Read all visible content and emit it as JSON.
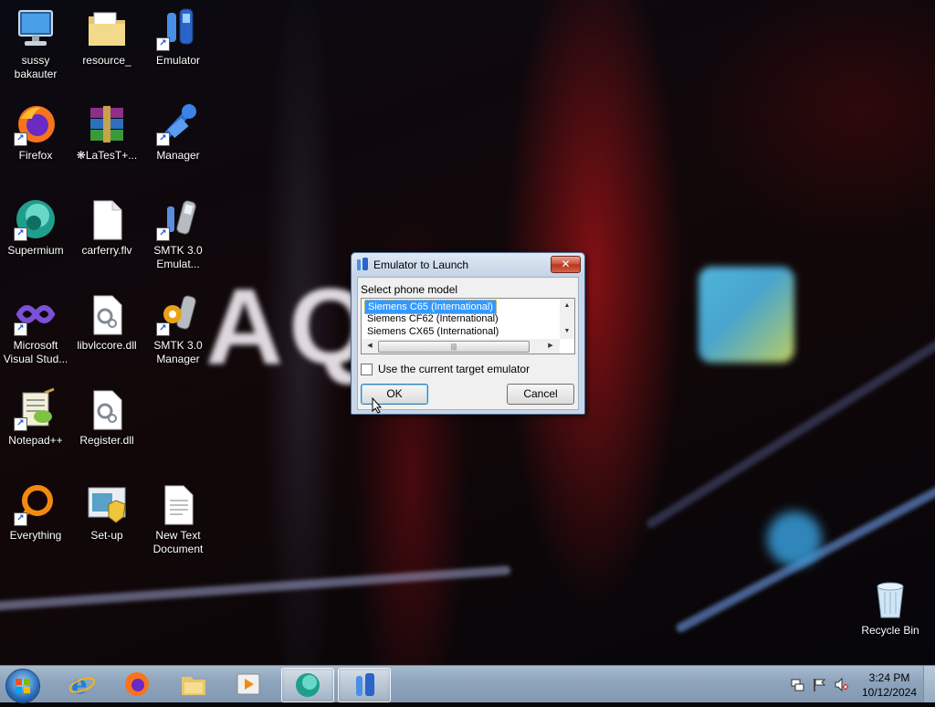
{
  "desktop": {
    "icons": [
      {
        "label": "sussy bakauter",
        "icon": "computer-icon"
      },
      {
        "label": "resource_",
        "icon": "folder-icon"
      },
      {
        "label": "Emulator",
        "icon": "emulator-icon"
      },
      {
        "label": "Firefox",
        "icon": "firefox-icon"
      },
      {
        "label": "❋LaTesT+...",
        "icon": "winrar-icon"
      },
      {
        "label": "Manager",
        "icon": "manager-icon"
      },
      {
        "label": "Supermium",
        "icon": "supermium-icon"
      },
      {
        "label": "carferry.flv",
        "icon": "file-icon"
      },
      {
        "label": "SMTK 3.0 Emulat...",
        "icon": "smtk-emulator-icon"
      },
      {
        "label": "Microsoft Visual Stud...",
        "icon": "visual-studio-icon"
      },
      {
        "label": "libvlccore.dll",
        "icon": "dll-icon"
      },
      {
        "label": "SMTK 3.0 Manager",
        "icon": "smtk-manager-icon"
      },
      {
        "label": "Notepad++",
        "icon": "notepadpp-icon"
      },
      {
        "label": "Register.dll",
        "icon": "dll-icon"
      },
      {
        "label": "Everything",
        "icon": "everything-icon"
      },
      {
        "label": "Set-up",
        "icon": "setup-icon"
      },
      {
        "label": "New Text Document",
        "icon": "text-document-icon"
      },
      {
        "label": "Recycle Bin",
        "icon": "recycle-bin-icon"
      }
    ]
  },
  "dialog": {
    "title": "Emulator to Launch",
    "close_label": "✕",
    "prompt": "Select phone model",
    "models": [
      "Siemens C65 (International)",
      "Siemens CF62 (International)",
      "Siemens CX65 (International)"
    ],
    "selected_index": 0,
    "checkbox_label": "Use the current target emulator",
    "checkbox_checked": false,
    "ok_label": "OK",
    "cancel_label": "Cancel"
  },
  "taskbar": {
    "pinned": [
      {
        "icon": "start-orb-icon"
      },
      {
        "icon": "internet-explorer-icon"
      },
      {
        "icon": "firefox-icon"
      },
      {
        "icon": "file-explorer-icon"
      },
      {
        "icon": "media-player-icon"
      },
      {
        "icon": "supermium-icon",
        "active": true
      },
      {
        "icon": "emulator-icon",
        "active": true
      }
    ],
    "tray": [
      "network-icon",
      "action-center-flag-icon",
      "volume-muted-icon"
    ],
    "time": "3:24 PM",
    "date": "10/12/2024"
  },
  "colors": {
    "dialog_frame": "#c7d6e8",
    "selection": "#3399ff",
    "taskbar": "#8ea5bd"
  }
}
